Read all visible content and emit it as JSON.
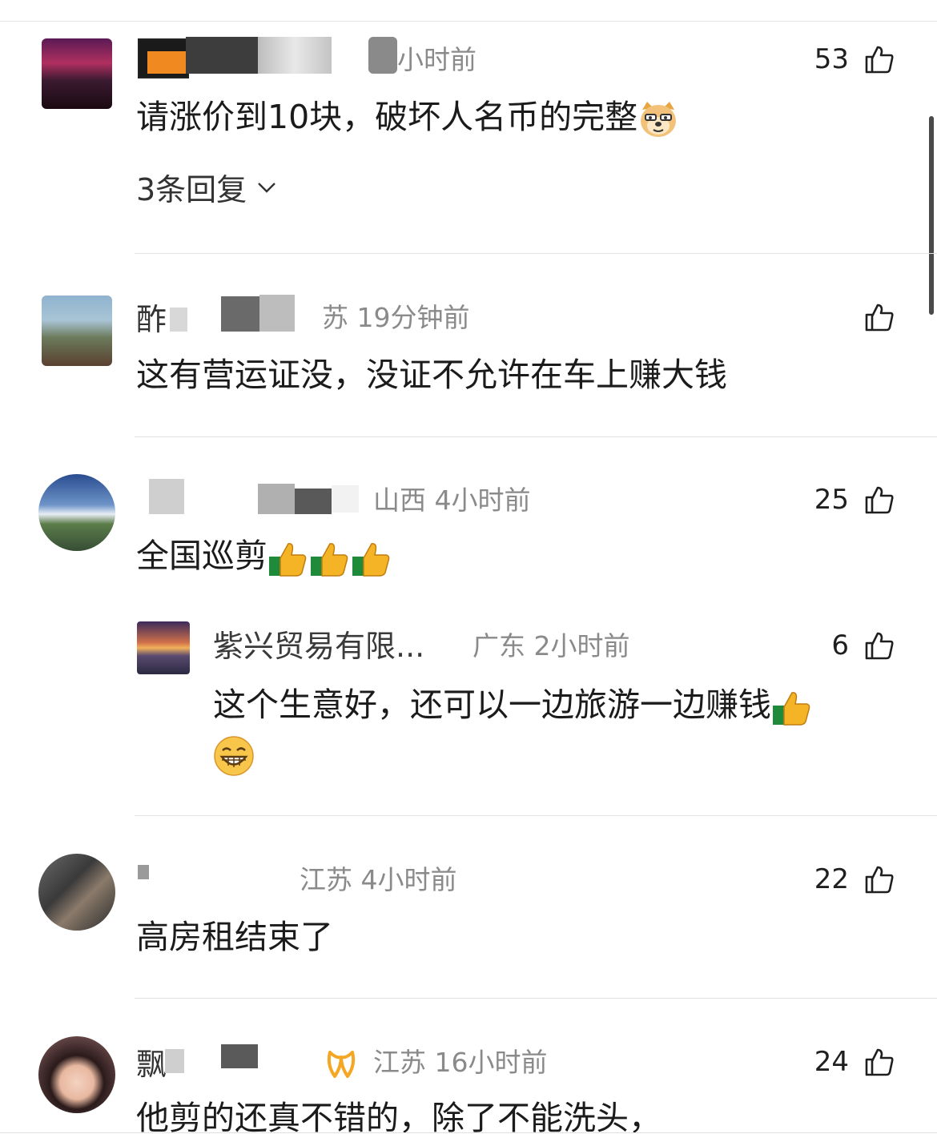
{
  "comments": [
    {
      "meta": "小时前",
      "likes": "53",
      "text": "请涨价到10块，破坏人名币的完整",
      "replies_label": "3条回复"
    },
    {
      "name_visible": "酢",
      "meta": "苏 19分钟前",
      "likes": "",
      "text": "这有营运证没，没证不允许在车上赚大钱"
    },
    {
      "meta": "山西 4小时前",
      "likes": "25",
      "text": "全国巡剪",
      "reply": {
        "name": "紫兴贸易有限...",
        "meta": "广东 2小时前",
        "likes": "6",
        "text": "这个生意好，还可以一边旅游一边赚钱"
      }
    },
    {
      "meta": "江苏 4小时前",
      "likes": "22",
      "text": "高房租结束了"
    },
    {
      "name_visible": "飘",
      "meta": "江苏 16小时前",
      "likes": "24",
      "text": "他剪的还真不错的，除了不能洗头，"
    }
  ],
  "colors": {
    "text": "#1b1b1b",
    "meta": "#8a8a8a",
    "divider": "#e3e3e3",
    "badge": "#f5a623"
  },
  "icons": [
    "thumbs-up-icon",
    "chevron-down-icon",
    "vip-badge-icon",
    "doge-emoji",
    "thumbs-up-emoji",
    "grin-emoji"
  ]
}
